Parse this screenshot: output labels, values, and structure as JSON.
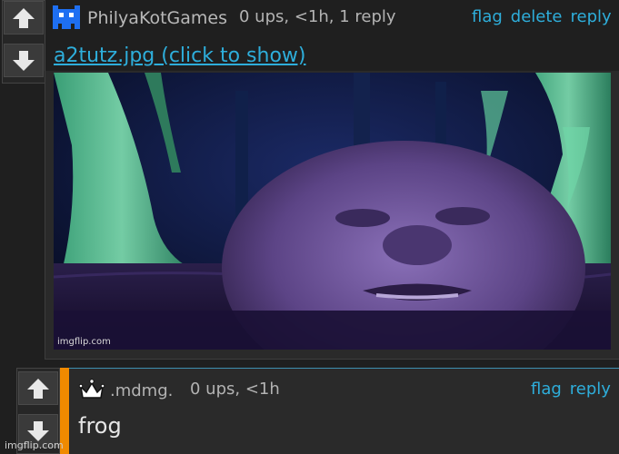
{
  "comment1": {
    "username": "PhilyaKotGames",
    "stats": "0 ups, <1h, 1 reply",
    "actions": [
      "flag",
      "delete",
      "reply"
    ],
    "attachment_link": "a2tutz.jpg (click to show)",
    "image_watermark": "imgflip.com",
    "avatar_icon": "pixel-creature-icon",
    "accent": "#2eaedb"
  },
  "comment2": {
    "username": ".mdmg.",
    "stats": "0 ups, <1h",
    "actions": [
      "flag",
      "reply"
    ],
    "body": "frog",
    "avatar_icon": "crown-icon",
    "indent_bar_color": "#f08a00"
  },
  "footer": {
    "watermark": "imgflip.com"
  }
}
